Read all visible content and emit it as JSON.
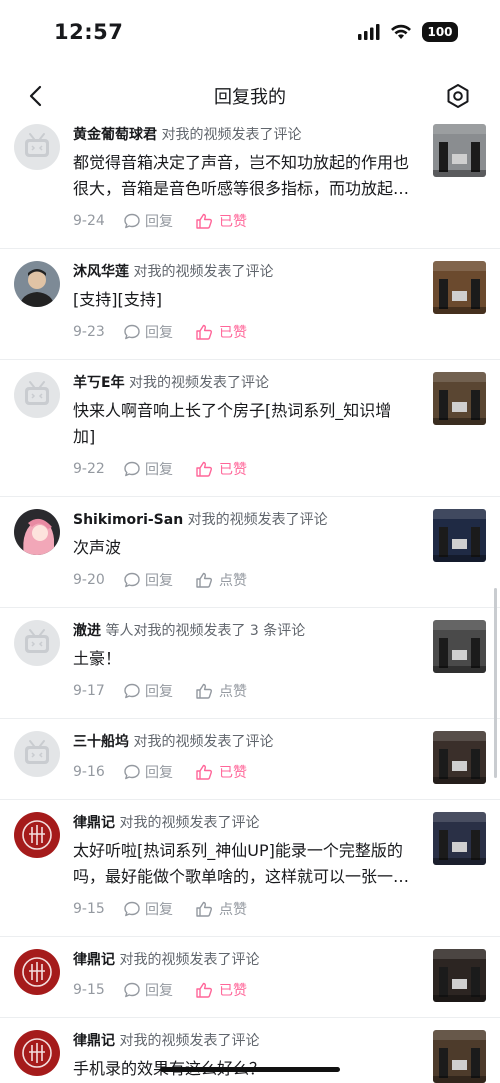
{
  "status_bar": {
    "time": "12:57",
    "battery": "100"
  },
  "header": {
    "title": "回复我的"
  },
  "actions": {
    "reply": "回复",
    "liked": "已赞",
    "like": "点赞"
  },
  "comments": [
    {
      "name": "黄金葡萄球君",
      "action": "对我的视频发表了评论",
      "text": "都觉得音箱决定了声音，岂不知功放起的作用也很大，音箱是音色听感等很多指标，而功放起的作用也很大",
      "date": "9-24",
      "like_label": "已赞",
      "liked": true,
      "avatar": "tv",
      "thumb": "#8a8d90"
    },
    {
      "name": "沐风华莲",
      "action": "对我的视频发表了评论",
      "text": "[支持][支持]",
      "date": "9-23",
      "like_label": "已赞",
      "liked": true,
      "avatar": "person",
      "thumb": "#6b4a2e"
    },
    {
      "name": "羊丂E年",
      "action": "对我的视频发表了评论",
      "text": "快来人啊音响上长了个房子[热词系列_知识增加]",
      "date": "9-22",
      "like_label": "已赞",
      "liked": true,
      "avatar": "tv",
      "thumb": "#5a4632"
    },
    {
      "name": "Shikimori-San",
      "action": "对我的视频发表了评论",
      "text": "次声波",
      "date": "9-20",
      "like_label": "点赞",
      "liked": false,
      "avatar": "anime",
      "thumb": "#1f2a44"
    },
    {
      "name": "澈进",
      "action": "等人对我的视频发表了 3 条评论",
      "text": "土豪！",
      "date": "9-17",
      "like_label": "点赞",
      "liked": false,
      "avatar": "tv",
      "thumb": "#4a4a4a"
    },
    {
      "name": "三十船坞",
      "action": "对我的视频发表了评论",
      "text": "",
      "date": "9-16",
      "like_label": "已赞",
      "liked": true,
      "avatar": "tv",
      "thumb": "#3a2f2a"
    },
    {
      "name": "律鼎记",
      "action": "对我的视频发表了评论",
      "text": "太好听啦[热词系列_神仙UP]能录一个完整版的吗，最好能做个歌单啥的，这样就可以一张一张地听了",
      "date": "9-15",
      "like_label": "点赞",
      "liked": false,
      "avatar": "seal",
      "thumb": "#2a3046"
    },
    {
      "name": "律鼎记",
      "action": "对我的视频发表了评论",
      "text": "",
      "date": "9-15",
      "like_label": "已赞",
      "liked": true,
      "avatar": "seal",
      "thumb": "#2c2522"
    },
    {
      "name": "律鼎记",
      "action": "对我的视频发表了评论",
      "text": "手机录的效果有这么好么？",
      "date": "9-15",
      "like_label": "已赞",
      "liked": true,
      "avatar": "seal",
      "thumb": "#4d3b2b"
    }
  ]
}
